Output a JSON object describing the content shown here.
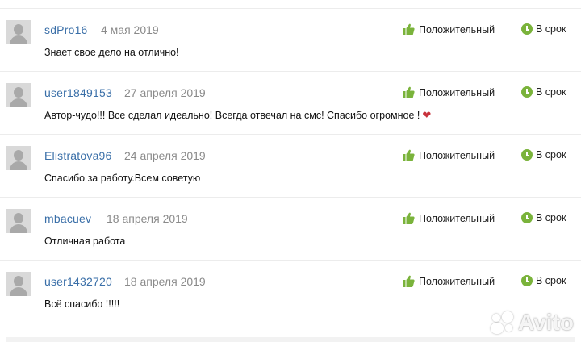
{
  "reviews": [
    {
      "user": "sdPro16",
      "date": "4 мая 2019",
      "text": "Знает свое дело на отлично!",
      "rating": "Положительный",
      "deadline": "В срок",
      "heart": ""
    },
    {
      "user": "user1849153",
      "date": "27 апреля 2019",
      "text": "Автор-чудо!!! Все сделал идеально! Всегда отвечал на смс! Спасибо огромное !",
      "rating": "Положительный",
      "deadline": "В срок",
      "heart": "❤"
    },
    {
      "user": "Elistratova96",
      "date": "24 апреля 2019",
      "text": "Спасибо за работу.Всем советую",
      "rating": "Положительный",
      "deadline": "В срок",
      "heart": ""
    },
    {
      "user": "mbacuev",
      "date": "18 апреля 2019",
      "text": "Отличная работа",
      "rating": "Положительный",
      "deadline": "В срок",
      "heart": ""
    },
    {
      "user": "user1432720",
      "date": "18 апреля 2019",
      "text": "Всё спасибо !!!!!",
      "rating": "Положительный",
      "deadline": "В срок",
      "heart": ""
    }
  ],
  "watermark": {
    "text": "Avito"
  },
  "colors": {
    "username": "#3a6fa8",
    "positive": "#7ab33b",
    "heart": "#c8323c"
  },
  "icons": {
    "rating": "thumbs-up-icon",
    "deadline": "clock-icon",
    "avatar": "default-avatar-icon"
  }
}
